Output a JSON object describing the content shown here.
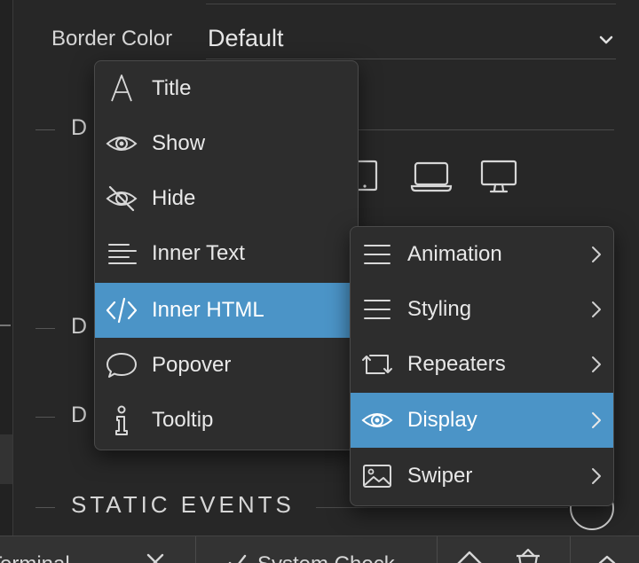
{
  "panel": {
    "border_color_label": "Border Color",
    "border_color_value": "Default",
    "section_letters": [
      "D",
      "D",
      "D"
    ],
    "static_events_title": "STATIC EVENTS"
  },
  "bottom_bar": {
    "terminal_label": "Terminal",
    "system_check_label": "System Check"
  },
  "context_menu": {
    "items": [
      {
        "label": "Title",
        "icon": "title-text-icon"
      },
      {
        "label": "Show",
        "icon": "eye-icon"
      },
      {
        "label": "Hide",
        "icon": "eye-off-icon"
      },
      {
        "label": "Inner Text",
        "icon": "align-left-icon"
      },
      {
        "label": "Inner HTML",
        "icon": "code-icon",
        "selected": true
      },
      {
        "label": "Popover",
        "icon": "speech-bubble-icon"
      },
      {
        "label": "Tooltip",
        "icon": "info-icon"
      }
    ]
  },
  "submenu": {
    "items": [
      {
        "label": "Animation",
        "icon": "menu-lines-icon"
      },
      {
        "label": "Styling",
        "icon": "menu-lines-icon"
      },
      {
        "label": "Repeaters",
        "icon": "repeat-icon"
      },
      {
        "label": "Display",
        "icon": "eye-icon",
        "selected": true
      },
      {
        "label": "Swiper",
        "icon": "image-icon"
      }
    ]
  },
  "colors": {
    "accent": "#4b94c7",
    "panel_bg": "#272727",
    "menu_bg": "#2d2d2d"
  }
}
